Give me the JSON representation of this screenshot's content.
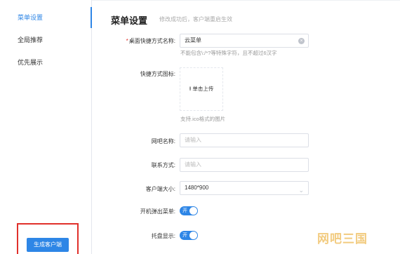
{
  "sidebar": {
    "items": [
      {
        "label": "菜单设置",
        "active": true
      },
      {
        "label": "全局推荐",
        "active": false
      },
      {
        "label": "优先展示",
        "active": false
      }
    ],
    "generate_button": "生成客户端"
  },
  "header": {
    "title": "菜单设置",
    "subtitle": "修改成功后，客户端重启生效"
  },
  "form": {
    "shortcut_name": {
      "label": "桌面快捷方式名称:",
      "value": "云菜单",
      "hint": "不能包含\\:/*?等特殊字符，且不超过6汉字"
    },
    "shortcut_icon": {
      "label": "快捷方式图标:",
      "upload_label": "单击上传",
      "hint": "支持.ico格式的图片"
    },
    "netbar_name": {
      "label": "网吧名称:",
      "placeholder": "请输入"
    },
    "contact": {
      "label": "联系方式:",
      "placeholder": "请输入"
    },
    "client_size": {
      "label": "客户端大小:",
      "value": "1480*900"
    },
    "popup_on_boot": {
      "label": "开机弹出菜单:",
      "state": "开"
    },
    "tray_display": {
      "label": "托盘显示:",
      "state": "开"
    }
  },
  "colors": {
    "accent": "#2e86e6",
    "danger": "#e0302b"
  },
  "watermark": "网吧三国"
}
